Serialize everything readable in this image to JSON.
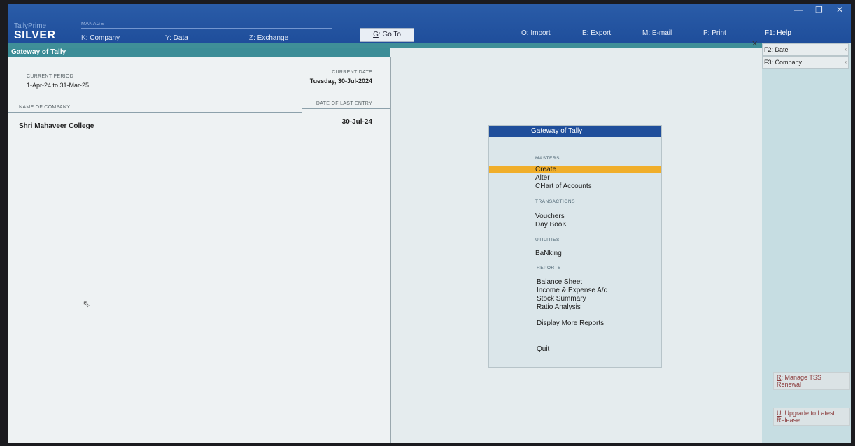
{
  "app": {
    "brand_small": "TallyPrime",
    "edition": "SILVER",
    "manage_label": "MANAGE"
  },
  "menus": {
    "company": {
      "key": "K",
      "label": ": Company"
    },
    "data": {
      "key": "Y",
      "label": ": Data"
    },
    "exchange": {
      "key": "Z",
      "label": ": Exchange"
    },
    "goto": {
      "key": "G",
      "label": ": Go To"
    }
  },
  "top_actions": [
    {
      "key": "O",
      "label": ": Import"
    },
    {
      "key": "E",
      "label": ": Export"
    },
    {
      "key": "M",
      "label": ": E-mail"
    },
    {
      "key": "P",
      "label": ": Print"
    }
  ],
  "help": {
    "key": "F1",
    "label": ": Help"
  },
  "window_controls": {
    "minimize": "—",
    "restore": "❐",
    "close": "✕"
  },
  "gateway": {
    "title": "Gateway of Tally",
    "current_period_label": "CURRENT PERIOD",
    "current_period": "1-Apr-24 to 31-Mar-25",
    "current_date_label": "CURRENT DATE",
    "current_date": "Tuesday, 30-Jul-2024",
    "company_col_label": "NAME OF COMPANY",
    "last_entry_col_label": "DATE OF LAST ENTRY",
    "company_name": "Shri Mahaveer College",
    "last_entry": "30-Jul-24"
  },
  "menu_box": {
    "title": "Gateway of Tally",
    "masters_label": "MASTERS",
    "create": "Create",
    "alter": "Alter",
    "chart": "CHart of Accounts",
    "transactions_label": "TRANSACTIONS",
    "vouchers": "Vouchers",
    "daybook": "Day BooK",
    "utilities_label": "UTILITIES",
    "banking": "BaNking",
    "reports_label": "REPORTS",
    "balance_sheet": "Balance Sheet",
    "income_expense": "Income & Expense A/c",
    "stock_summary": "Stock Summary",
    "ratio_analysis": "Ratio Analysis",
    "more_reports": "Display More Reports",
    "quit": "Quit"
  },
  "side": {
    "f2": "F2: Date",
    "f3": "F3: Company",
    "manage_tss": {
      "key": "R",
      "label": ": Manage TSS Renewal"
    },
    "upgrade": {
      "key": "U",
      "label": ": Upgrade to Latest Release"
    }
  },
  "colors": {
    "title_bar": "#1f4e9b",
    "teal": "#3c8d97",
    "highlight": "#f0ae2a"
  }
}
